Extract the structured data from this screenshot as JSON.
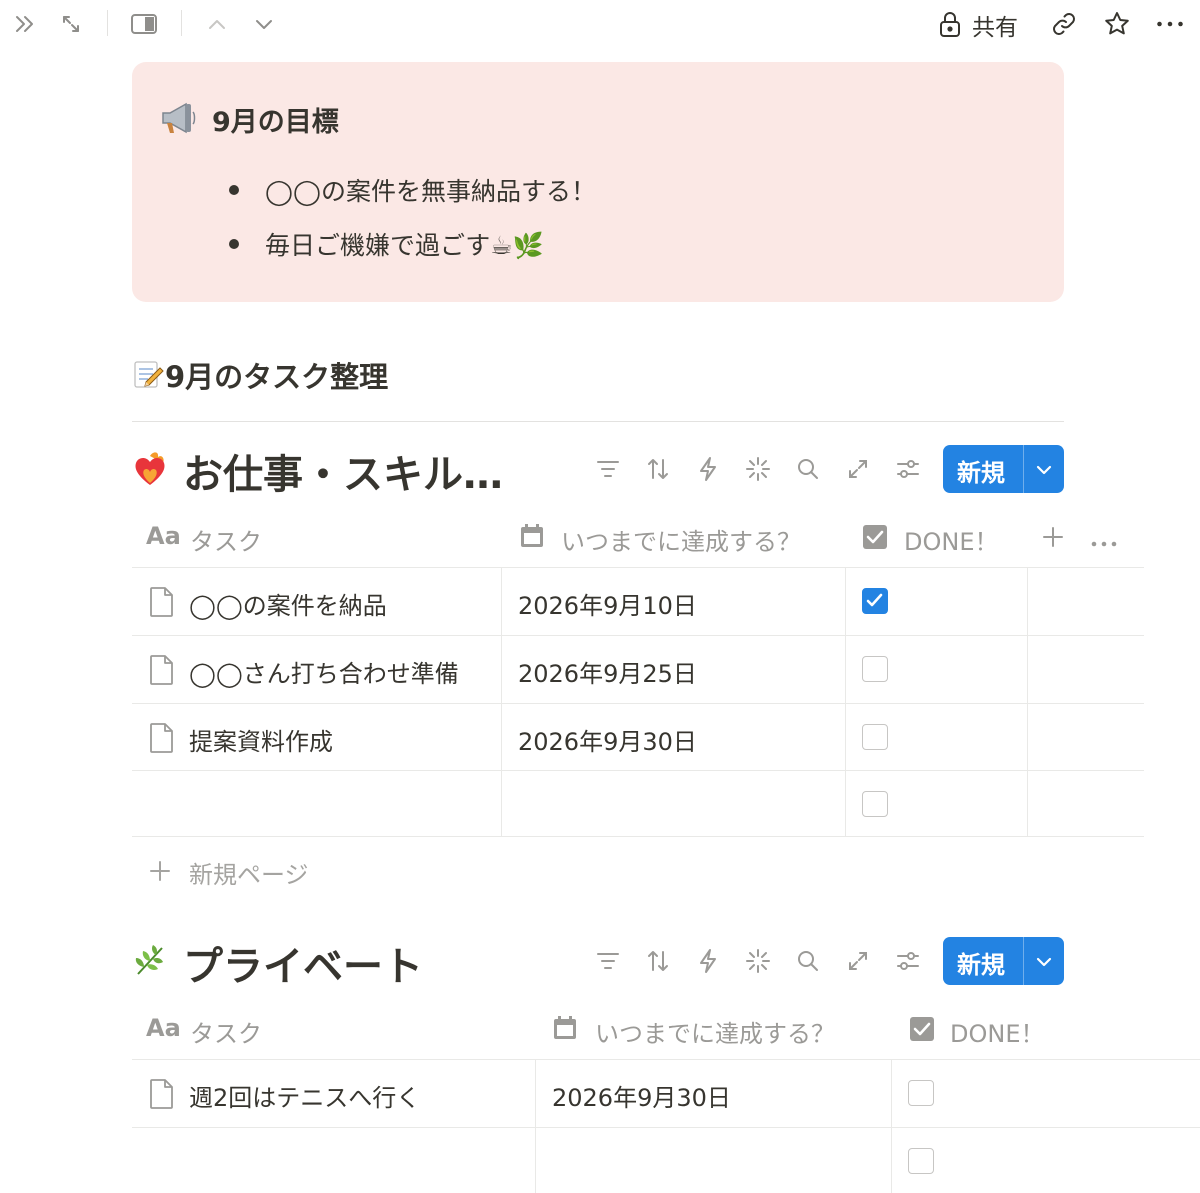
{
  "topbar": {
    "share_label": "共有"
  },
  "callout": {
    "icon": "megaphone-icon",
    "title": "9月の目標",
    "bullets": [
      "◯◯の案件を無事納品する！",
      "毎日ご機嫌で過ごす☕🌿"
    ]
  },
  "section": {
    "emoji": "📝",
    "title": "9月のタスク整理"
  },
  "db1": {
    "emoji": "❤️‍🔥",
    "title": "お仕事・スキル…",
    "new_label": "新規",
    "columns": {
      "task": "タスク",
      "task_icon": "Aa",
      "date": "いつまでに達成する？",
      "done": "DONE！"
    },
    "rows": [
      {
        "task": "◯◯の案件を納品",
        "date": "2026年9月10日",
        "done": true
      },
      {
        "task": "◯◯さん打ち合わせ準備",
        "date": "2026年9月25日",
        "done": false
      },
      {
        "task": "提案資料作成",
        "date": "2026年9月30日",
        "done": false
      },
      {
        "task": "",
        "date": "",
        "done": false
      }
    ],
    "new_page_label": "新規ページ"
  },
  "db2": {
    "emoji": "🌿",
    "title": "プライベート",
    "new_label": "新規",
    "columns": {
      "task": "タスク",
      "task_icon": "Aa",
      "date": "いつまでに達成する？",
      "done": "DONE！"
    },
    "rows": [
      {
        "task": "週2回はテニスへ行く",
        "date": "2026年9月30日",
        "done": false
      },
      {
        "task": "",
        "date": "",
        "done": false
      }
    ]
  },
  "colors": {
    "accent": "#2383e2",
    "callout_bg": "#fbe8e5",
    "text": "#37352f",
    "muted": "#9b9a97"
  }
}
